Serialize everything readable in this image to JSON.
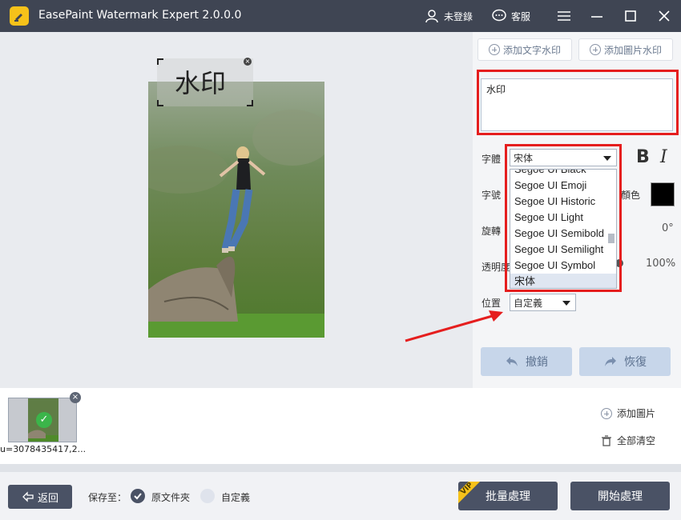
{
  "titlebar": {
    "app_title": "EasePaint Watermark Expert  2.0.0.0",
    "user_label": "未登錄",
    "service_label": "客服"
  },
  "canvas": {
    "watermark_text": "水印"
  },
  "panel": {
    "add_text_watermark": "添加文字水印",
    "add_image_watermark": "添加圖片水印",
    "watermark_input_value": "水印",
    "font_label": "字體",
    "font_value": "宋体",
    "size_label": "字號",
    "color_label": "顏色",
    "rotate_label": "旋轉",
    "rotate_value": "0°",
    "opacity_label": "透明度",
    "opacity_value": "100%",
    "position_label": "位置",
    "position_value": "自定義",
    "bold_label": "B",
    "italic_label": "I",
    "undo_label": "撤銷",
    "redo_label": "恢復",
    "font_options": [
      "Segoe UI Black",
      "Segoe UI Emoji",
      "Segoe UI Historic",
      "Segoe UI Light",
      "Segoe UI Semibold",
      "Segoe UI Semilight",
      "Segoe UI Symbol",
      "宋体"
    ]
  },
  "thumbs": {
    "file_name": "u=3078435417,2..."
  },
  "side_actions": {
    "add_image": "添加圖片",
    "clear_all": "全部清空"
  },
  "bottombar": {
    "back_label": "返回",
    "save_to_label": "保存至：",
    "original_folder": "原文件夾",
    "custom": "自定義",
    "batch_label": "批量處理",
    "vip_badge": "VIP",
    "start_label": "開始處理"
  }
}
